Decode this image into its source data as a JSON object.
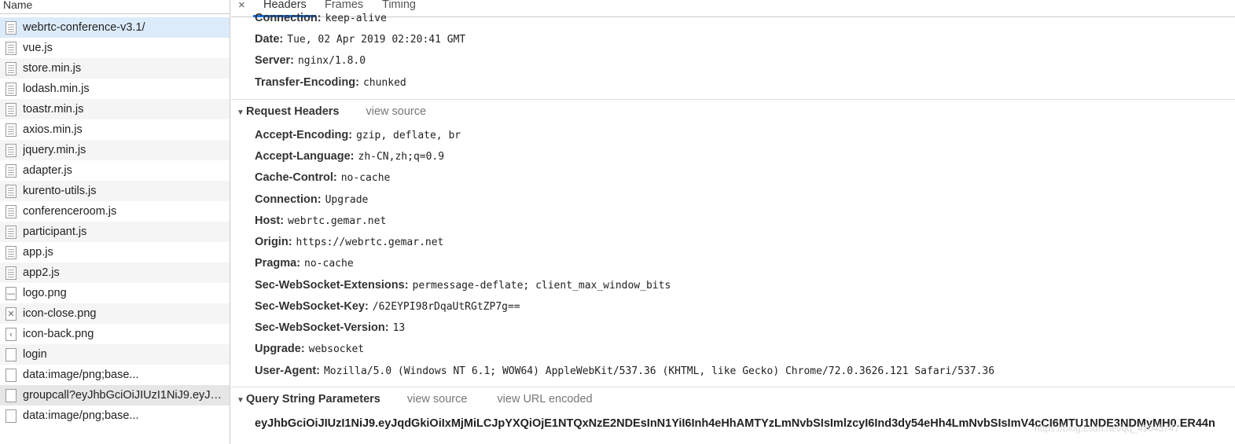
{
  "request_list": {
    "column_header": "Name",
    "items": [
      {
        "name": "webrtc-conference-v3.1/",
        "icon": "document-icon"
      },
      {
        "name": "vue.js",
        "icon": "document-icon"
      },
      {
        "name": "store.min.js",
        "icon": "document-icon"
      },
      {
        "name": "lodash.min.js",
        "icon": "document-icon"
      },
      {
        "name": "toastr.min.js",
        "icon": "document-icon"
      },
      {
        "name": "axios.min.js",
        "icon": "document-icon"
      },
      {
        "name": "jquery.min.js",
        "icon": "document-icon"
      },
      {
        "name": "adapter.js",
        "icon": "document-icon"
      },
      {
        "name": "kurento-utils.js",
        "icon": "document-icon"
      },
      {
        "name": "conferenceroom.js",
        "icon": "document-icon"
      },
      {
        "name": "participant.js",
        "icon": "document-icon"
      },
      {
        "name": "app.js",
        "icon": "document-icon"
      },
      {
        "name": "app2.js",
        "icon": "document-icon"
      },
      {
        "name": "logo.png",
        "icon": "image-icon"
      },
      {
        "name": "icon-close.png",
        "icon": "close-image-icon"
      },
      {
        "name": "icon-back.png",
        "icon": "back-image-icon"
      },
      {
        "name": "login",
        "icon": "blank-file-icon"
      },
      {
        "name": "data:image/png;base...",
        "icon": "blank-file-icon"
      },
      {
        "name": "groupcall?eyJhbGciOiJIUzI1NiJ9.eyJq...",
        "icon": "blank-file-icon"
      },
      {
        "name": "data:image/png;base...",
        "icon": "blank-file-icon"
      }
    ]
  },
  "detail": {
    "close_glyph": "×",
    "tabs": [
      "Headers",
      "Frames",
      "Timing"
    ],
    "response_headers": [
      {
        "key": "Connection:",
        "value": "keep-alive"
      },
      {
        "key": "Date:",
        "value": "Tue, 02 Apr 2019 02:20:41 GMT"
      },
      {
        "key": "Server:",
        "value": "nginx/1.8.0"
      },
      {
        "key": "Transfer-Encoding:",
        "value": "chunked"
      }
    ],
    "request_headers_section": {
      "title": "Request Headers",
      "link": "view source"
    },
    "request_headers": [
      {
        "key": "Accept-Encoding:",
        "value": "gzip, deflate, br"
      },
      {
        "key": "Accept-Language:",
        "value": "zh-CN,zh;q=0.9"
      },
      {
        "key": "Cache-Control:",
        "value": "no-cache"
      },
      {
        "key": "Connection:",
        "value": "Upgrade"
      },
      {
        "key": "Host:",
        "value": "webrtc.gemar.net"
      },
      {
        "key": "Origin:",
        "value": "https://webrtc.gemar.net"
      },
      {
        "key": "Pragma:",
        "value": "no-cache"
      },
      {
        "key": "Sec-WebSocket-Extensions:",
        "value": "permessage-deflate; client_max_window_bits"
      },
      {
        "key": "Sec-WebSocket-Key:",
        "value": "/62EYPI98rDqaUtRGtZP7g=="
      },
      {
        "key": "Sec-WebSocket-Version:",
        "value": "13"
      },
      {
        "key": "Upgrade:",
        "value": "websocket"
      },
      {
        "key": "User-Agent:",
        "value": "Mozilla/5.0 (Windows NT 6.1; WOW64) AppleWebKit/537.36 (KHTML, like Gecko) Chrome/72.0.3626.121 Safari/537.36"
      }
    ],
    "query_section": {
      "title": "Query String Parameters",
      "link_source": "view source",
      "link_encoded": "view URL encoded"
    },
    "query_string": "eyJhbGciOiJIUzI1NiJ9.eyJqdGkiOiIxMjMiLCJpYXQiOjE1NTQxNzE2NDEsInN1YiI6Inh4eHhAMTYzLmNvbSIsImlzcyI6Ind3dy54eHh4LmNvbSIsImV4cCI6MTU1NDE3NDMyMH0.ER44n",
    "watermark": "https://blog.csdn.net/qq_41043747"
  }
}
